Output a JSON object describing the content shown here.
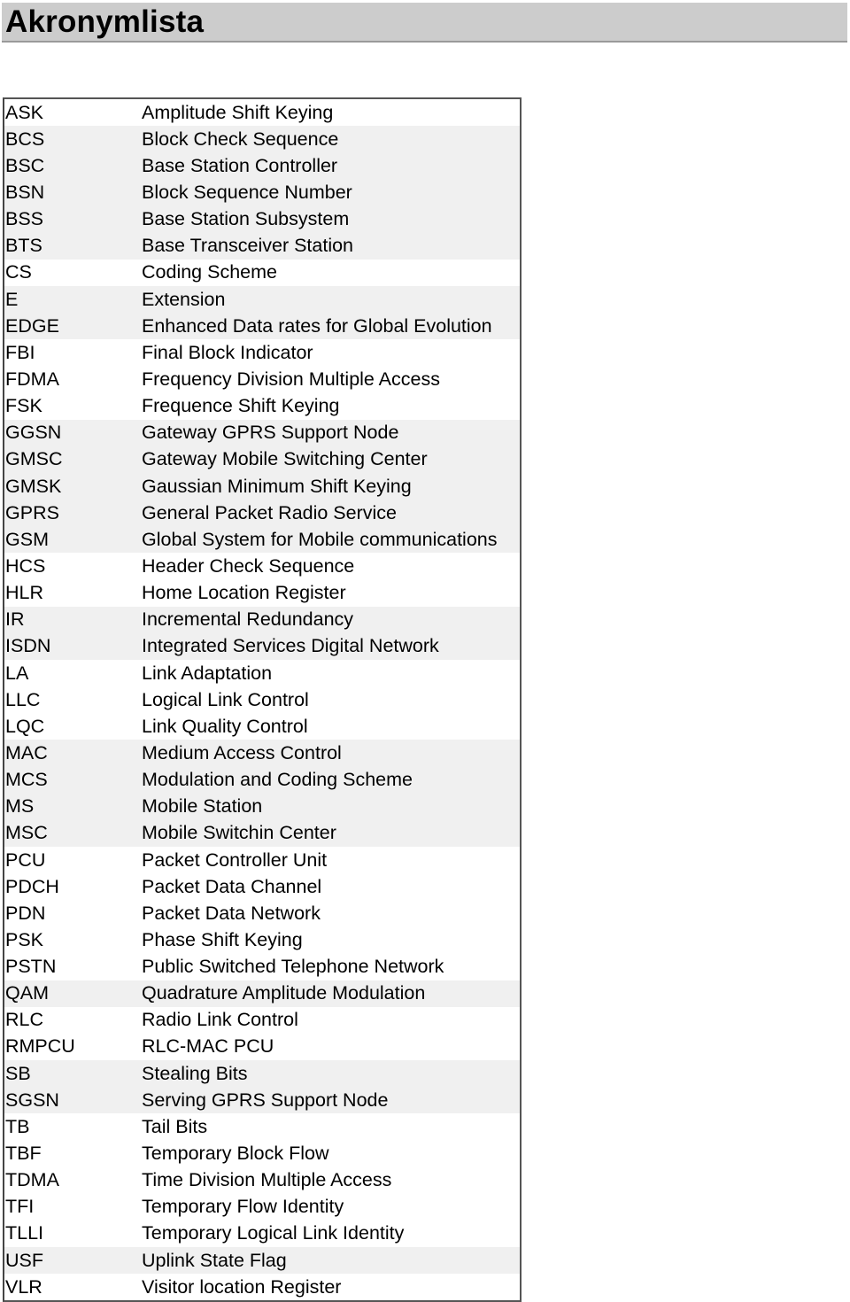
{
  "title": "Akronymlista",
  "colors": {
    "title_bar": "#cccccc",
    "stripe": "#f0f0f0"
  },
  "acronyms": [
    {
      "abbr": "ASK",
      "desc": "Amplitude Shift Keying"
    },
    {
      "abbr": "BCS",
      "desc": "Block Check Sequence"
    },
    {
      "abbr": "BSC",
      "desc": "Base Station Controller"
    },
    {
      "abbr": "BSN",
      "desc": "Block Sequence Number"
    },
    {
      "abbr": "BSS",
      "desc": "Base Station Subsystem"
    },
    {
      "abbr": "BTS",
      "desc": "Base Transceiver Station"
    },
    {
      "abbr": "CS",
      "desc": "Coding Scheme"
    },
    {
      "abbr": "E",
      "desc": "Extension"
    },
    {
      "abbr": "EDGE",
      "desc": "Enhanced Data rates for Global Evolution"
    },
    {
      "abbr": "FBI",
      "desc": "Final Block Indicator"
    },
    {
      "abbr": "FDMA",
      "desc": "Frequency Division Multiple Access"
    },
    {
      "abbr": "FSK",
      "desc": "Frequence Shift Keying"
    },
    {
      "abbr": "GGSN",
      "desc": "Gateway GPRS Support Node"
    },
    {
      "abbr": "GMSC",
      "desc": "Gateway Mobile Switching Center"
    },
    {
      "abbr": "GMSK",
      "desc": "Gaussian Minimum Shift Keying"
    },
    {
      "abbr": "GPRS",
      "desc": "General Packet Radio Service"
    },
    {
      "abbr": "GSM",
      "desc": "Global System for Mobile communications"
    },
    {
      "abbr": "HCS",
      "desc": "Header Check Sequence"
    },
    {
      "abbr": "HLR",
      "desc": "Home Location Register"
    },
    {
      "abbr": "IR",
      "desc": "Incremental Redundancy"
    },
    {
      "abbr": "ISDN",
      "desc": "Integrated Services Digital Network"
    },
    {
      "abbr": "LA",
      "desc": "Link Adaptation"
    },
    {
      "abbr": "LLC",
      "desc": "Logical Link Control"
    },
    {
      "abbr": "LQC",
      "desc": "Link Quality Control"
    },
    {
      "abbr": "MAC",
      "desc": "Medium Access Control"
    },
    {
      "abbr": "MCS",
      "desc": "Modulation and Coding Scheme"
    },
    {
      "abbr": "MS",
      "desc": "Mobile Station"
    },
    {
      "abbr": "MSC",
      "desc": "Mobile Switchin Center"
    },
    {
      "abbr": "PCU",
      "desc": "Packet Controller Unit"
    },
    {
      "abbr": "PDCH",
      "desc": "Packet Data Channel"
    },
    {
      "abbr": "PDN",
      "desc": "Packet Data Network"
    },
    {
      "abbr": "PSK",
      "desc": "Phase Shift Keying"
    },
    {
      "abbr": "PSTN",
      "desc": "Public Switched Telephone Network"
    },
    {
      "abbr": "QAM",
      "desc": "Quadrature Amplitude Modulation"
    },
    {
      "abbr": "RLC",
      "desc": "Radio Link Control"
    },
    {
      "abbr": "RMPCU",
      "desc": "RLC-MAC PCU"
    },
    {
      "abbr": "SB",
      "desc": "Stealing Bits"
    },
    {
      "abbr": "SGSN",
      "desc": "Serving GPRS Support Node"
    },
    {
      "abbr": "TB",
      "desc": "Tail Bits"
    },
    {
      "abbr": "TBF",
      "desc": "Temporary Block Flow"
    },
    {
      "abbr": "TDMA",
      "desc": "Time Division Multiple Access"
    },
    {
      "abbr": "TFI",
      "desc": "Temporary Flow Identity"
    },
    {
      "abbr": "TLLI",
      "desc": "Temporary Logical Link Identity"
    },
    {
      "abbr": "USF",
      "desc": "Uplink State Flag"
    },
    {
      "abbr": "VLR",
      "desc": "Visitor location Register"
    }
  ]
}
